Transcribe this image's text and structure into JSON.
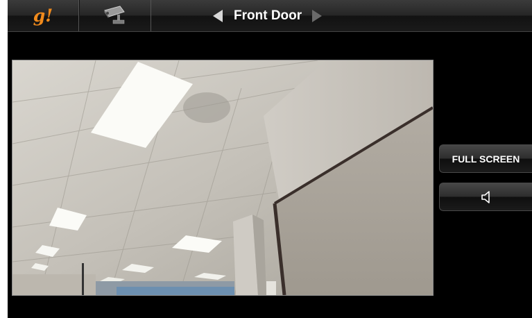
{
  "header": {
    "logo_text": "g!",
    "camera_icon": "security-camera-icon",
    "camera_name": "Front Door",
    "prev_icon": "triangle-left-icon",
    "next_icon": "triangle-right-icon"
  },
  "controls": {
    "full_screen_label": "FULL SCREEN",
    "audio_icon": "speaker-icon"
  },
  "colors": {
    "logo": "#f08a1c",
    "background": "#000000",
    "button_text": "#ffffff"
  }
}
